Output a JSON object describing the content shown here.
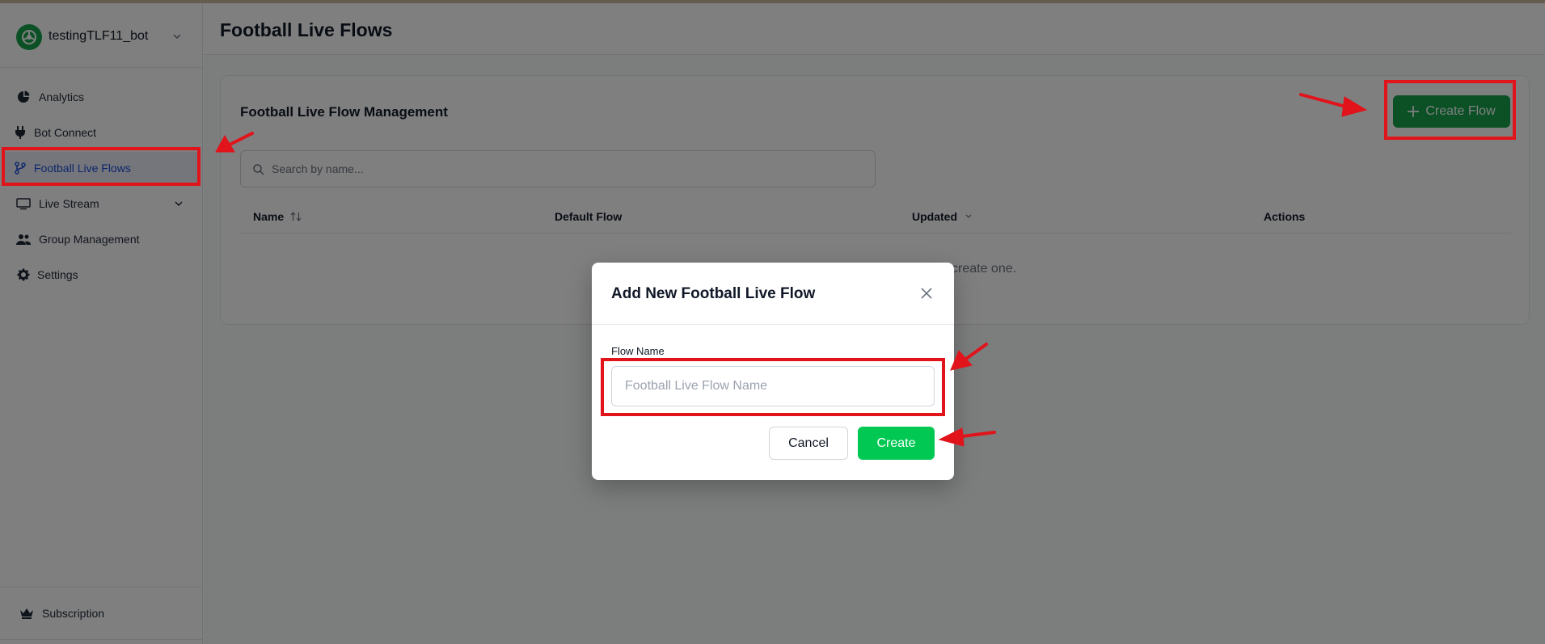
{
  "sidebar": {
    "bot_name": "testingTLF11_bot",
    "items": [
      {
        "label": "Analytics",
        "icon": "pie-chart-icon"
      },
      {
        "label": "Bot Connect",
        "icon": "plug-icon"
      },
      {
        "label": "Football Live Flows",
        "icon": "git-branch-icon",
        "active": true
      },
      {
        "label": "Live Stream",
        "icon": "monitor-icon"
      },
      {
        "label": "Group Management",
        "icon": "users-icon"
      },
      {
        "label": "Settings",
        "icon": "gear-icon"
      }
    ],
    "bottom_item": {
      "label": "Subscription",
      "icon": "crown-icon"
    }
  },
  "main": {
    "page_title": "Football Live Flows",
    "card_title": "Football Live Flow Management",
    "create_button": "Create Flow",
    "search_placeholder": "Search by name...",
    "columns": [
      "Name",
      "Default Flow",
      "Updated",
      "Actions"
    ],
    "empty_text_visible": "create one."
  },
  "modal": {
    "title": "Add New Football Live Flow",
    "field_label": "Flow Name",
    "field_placeholder": "Football Live Flow Name",
    "cancel_label": "Cancel",
    "create_label": "Create"
  },
  "colors": {
    "accent_green": "#16a34a",
    "create_green": "#00c853",
    "annotation_red": "#e1131b",
    "active_blue": "#1d4ed8"
  }
}
